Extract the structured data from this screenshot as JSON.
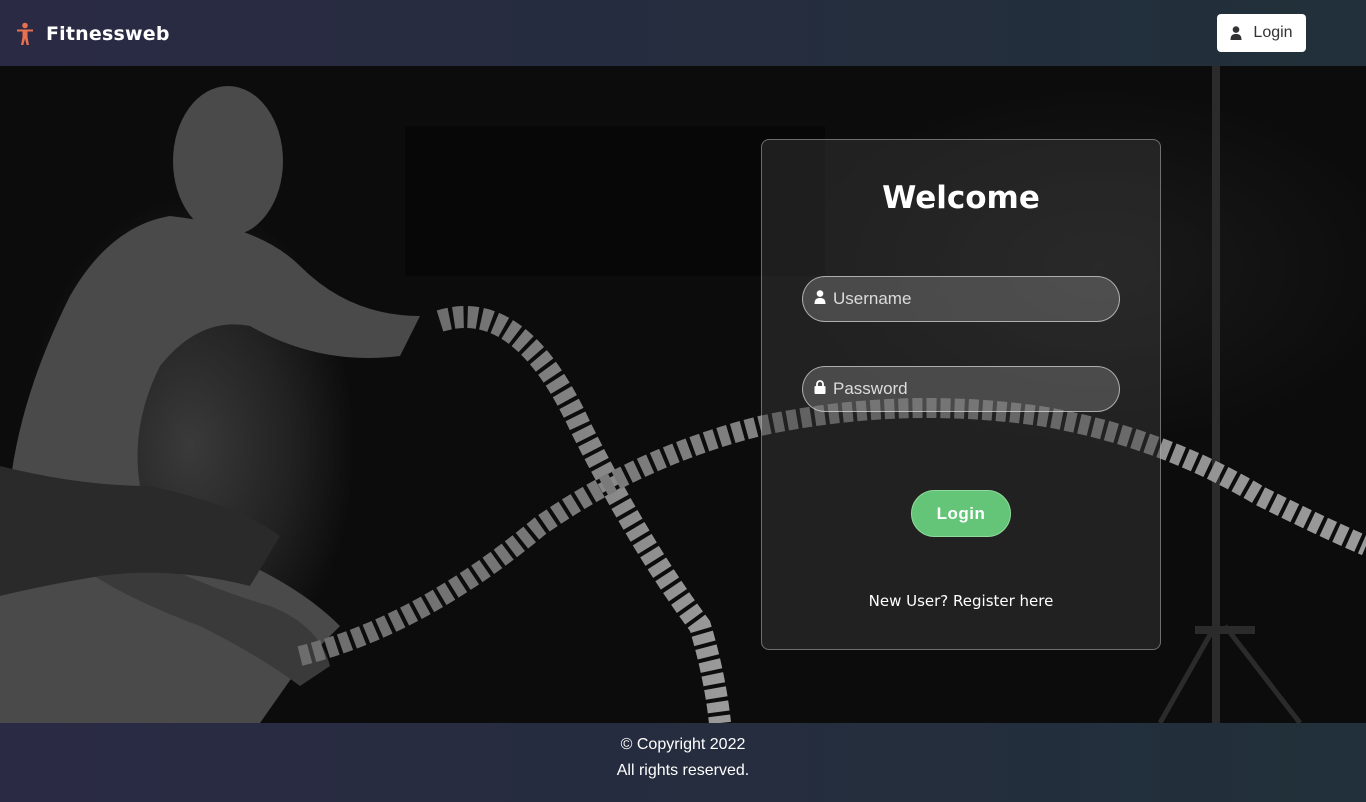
{
  "navbar": {
    "brand_name": "Fitnessweb",
    "brand_icon": "person-standing-icon",
    "brand_icon_color": "#e8704f",
    "login_label": "Login",
    "login_icon": "user-icon"
  },
  "card": {
    "title": "Welcome",
    "username_placeholder": "Username",
    "username_value": "",
    "password_placeholder": "Password",
    "password_value": "",
    "login_label": "Login",
    "login_color": "#64c477",
    "register_text": "New User? Register here"
  },
  "footer": {
    "copyright": "© Copyright 2022",
    "rights": "All rights reserved."
  }
}
